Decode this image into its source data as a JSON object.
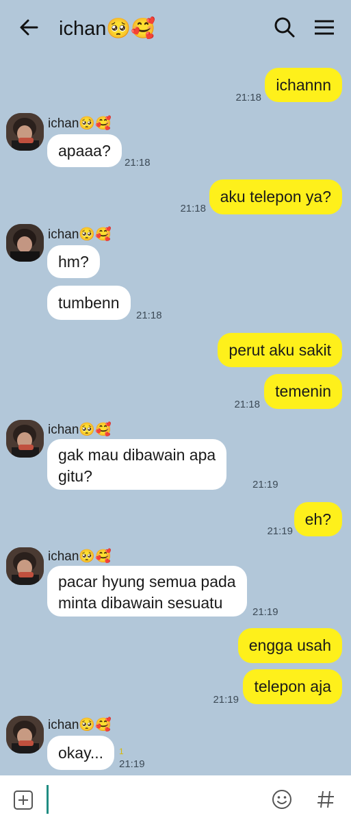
{
  "header": {
    "title": "ichan🥺🥰",
    "back_icon": "arrow-left-icon",
    "search_icon": "search-icon",
    "menu_icon": "hamburger-menu-icon"
  },
  "contact": {
    "name": "ichan🥺🥰"
  },
  "messages": [
    {
      "from": "me",
      "text": "ichannn",
      "time": "21:18"
    },
    {
      "from": "ichan",
      "text": "apaaa?",
      "time": "21:18"
    },
    {
      "from": "me",
      "text": "aku telepon ya?",
      "time": "21:18"
    },
    {
      "from": "ichan",
      "text": "hm?"
    },
    {
      "from": "ichan",
      "text": "tumbenn",
      "time": "21:18"
    },
    {
      "from": "me",
      "text": "perut aku sakit"
    },
    {
      "from": "me",
      "text": "temenin",
      "time": "21:18"
    },
    {
      "from": "ichan",
      "lines": [
        "gak mau dibawain apa",
        "gitu?"
      ],
      "time": "21:19"
    },
    {
      "from": "me",
      "text": "eh?",
      "time": "21:19"
    },
    {
      "from": "ichan",
      "lines": [
        "pacar hyung semua pada",
        "minta dibawain sesuatu"
      ],
      "time": "21:19"
    },
    {
      "from": "me",
      "text": "engga usah"
    },
    {
      "from": "me",
      "text": "telepon aja",
      "time": "21:19"
    },
    {
      "from": "ichan",
      "text": "okay...",
      "time": "21:19",
      "unread": "1"
    }
  ],
  "input": {
    "add_icon": "plus-square-icon",
    "emoji_icon": "smiley-icon",
    "hashtag_icon": "hashtag-icon"
  },
  "colors": {
    "background": "#b2c7d9",
    "my_bubble": "#fef01b",
    "their_bubble": "#ffffff"
  }
}
